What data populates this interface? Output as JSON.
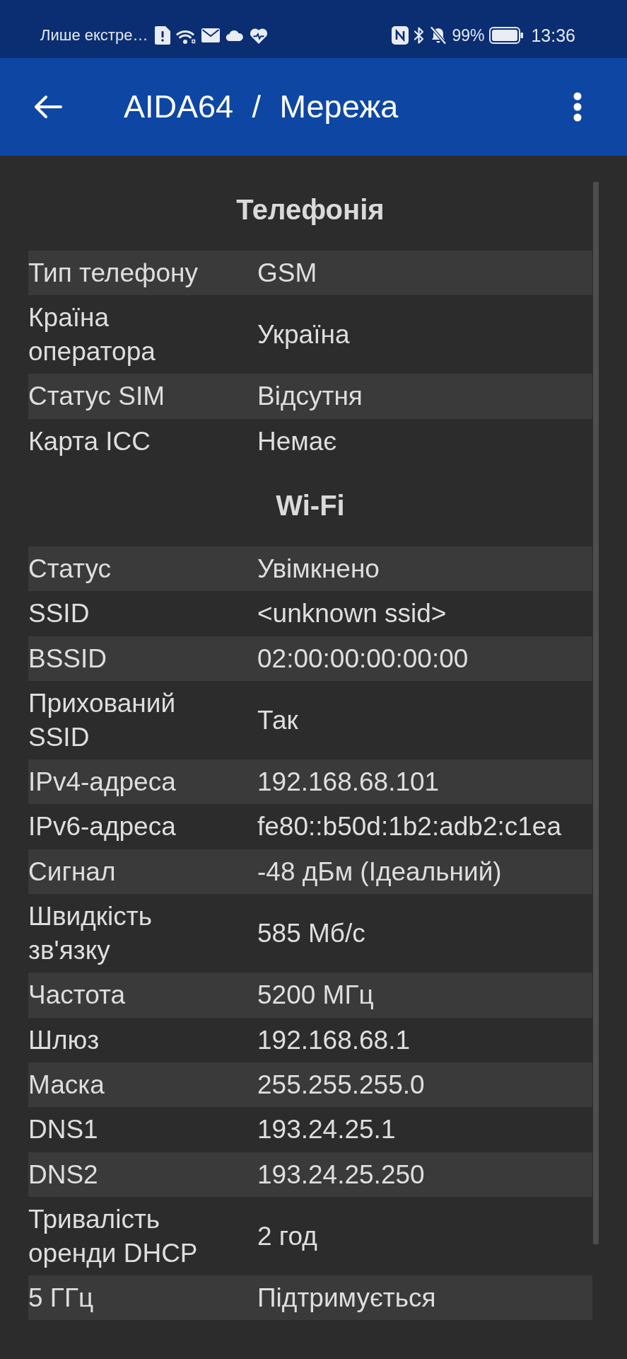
{
  "status_bar": {
    "notification_text": "Лише екстре…",
    "battery": "99%",
    "time": "13:36"
  },
  "app_bar": {
    "title": "AIDA64 / Мережа"
  },
  "sections": [
    {
      "title": "Телефонія",
      "rows": [
        {
          "label": "Тип телефону",
          "value": "GSM"
        },
        {
          "label": "Країна оператора",
          "value": "Україна"
        },
        {
          "label": "Статус SIM",
          "value": "Відсутня"
        },
        {
          "label": "Карта ICC",
          "value": "Немає"
        }
      ]
    },
    {
      "title": "Wi-Fi",
      "rows": [
        {
          "label": "Статус",
          "value": "Увімкнено"
        },
        {
          "label": "SSID",
          "value": "<unknown ssid>"
        },
        {
          "label": "BSSID",
          "value": "02:00:00:00:00:00"
        },
        {
          "label": "Прихований SSID",
          "value": "Так"
        },
        {
          "label": "IPv4-адреса",
          "value": "192.168.68.101"
        },
        {
          "label": "IPv6-адреса",
          "value": "fe80::b50d:1b2:adb2:c1ea"
        },
        {
          "label": "Сигнал",
          "value": "-48 дБм (Ідеальний)"
        },
        {
          "label": "Швидкість зв'язку",
          "value": "585 Мб/с"
        },
        {
          "label": "Частота",
          "value": "5200 МГц"
        },
        {
          "label": "Шлюз",
          "value": "192.168.68.1"
        },
        {
          "label": "Маска",
          "value": "255.255.255.0"
        },
        {
          "label": "DNS1",
          "value": "193.24.25.1"
        },
        {
          "label": "DNS2",
          "value": "193.24.25.250"
        },
        {
          "label": "Тривалість оренди DHCP",
          "value": "2 год"
        },
        {
          "label": "5 ГГц",
          "value": "Підтримується"
        }
      ]
    }
  ]
}
